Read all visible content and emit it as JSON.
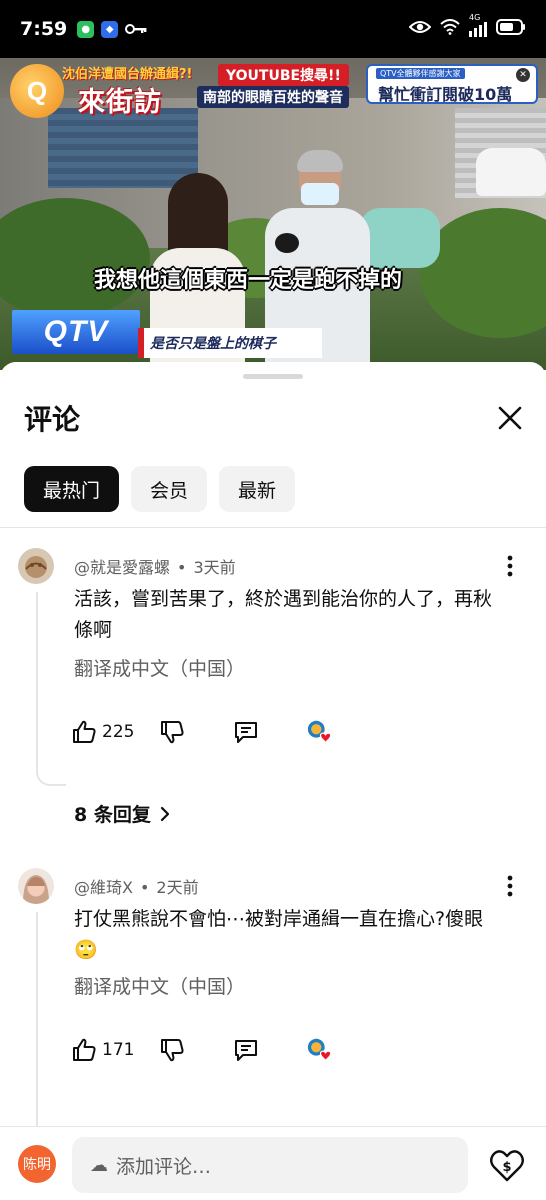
{
  "status_bar": {
    "time": "7:59",
    "network": "4G",
    "icons": [
      "wechat-icon",
      "app-icon",
      "key-icon",
      "eye-icon",
      "wifi-icon",
      "signal-icon",
      "battery-icon"
    ]
  },
  "video": {
    "logo_small": "沈伯洋遭國台辦通緝?!",
    "logo_main": "來街訪",
    "logo_letter": "Q",
    "yt_banner": "YOUTUBE搜尋!!",
    "yt_sub": "南部的眼睛百姓的聲音",
    "promo_top": "QTV全體夥伴感謝大家",
    "promo_main": "幫忙衝訂閱破10萬",
    "subtitle": "我想他這個東西一定是跑不掉的",
    "qtv_label": "QTV",
    "lower_third": "是否只是盤上的棋子"
  },
  "sheet": {
    "title": "评论",
    "chips": [
      {
        "label": "最热门",
        "active": true
      },
      {
        "label": "会员",
        "active": false
      },
      {
        "label": "最新",
        "active": false
      }
    ]
  },
  "comments": [
    {
      "author": "@就是愛露螺",
      "time": "3天前",
      "text": "活該，嘗到苦果了，終於遇到能治你的人了，再秋條啊",
      "translate": "翻译成中文（中国）",
      "likes": "225",
      "replies": "8 条回复"
    },
    {
      "author": "@維琦X",
      "time": "2天前",
      "text": "打仗黑熊說不會怕⋯被對岸通緝一直在擔心?傻眼🙄",
      "translate": "翻译成中文（中国）",
      "likes": "171"
    }
  ],
  "bottom": {
    "me_avatar": "陈明",
    "add_placeholder": "添加评论…"
  },
  "colors": {
    "text_primary": "#0f0f0f",
    "text_secondary": "#606060",
    "chip_active": "#0f0f0f",
    "chip_bg": "#f2f2f2",
    "avatar_me": "#f26430",
    "heart": "#e8192c"
  }
}
